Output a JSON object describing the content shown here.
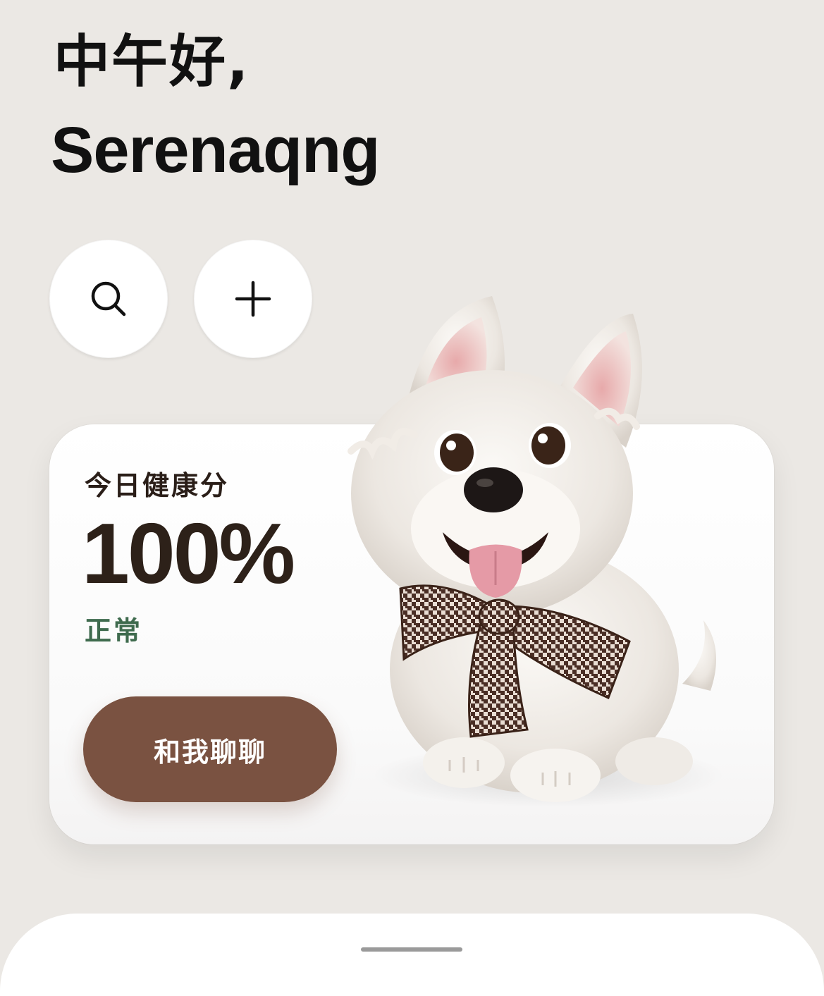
{
  "header": {
    "greeting": "中午好,",
    "username": "Serenaqng"
  },
  "actions": {
    "search_icon": "search-icon",
    "add_icon": "plus-icon"
  },
  "health_card": {
    "label": "今日健康分",
    "score": "100%",
    "status": "正常",
    "chat_button": "和我聊聊",
    "mascot": "white-puppy-with-houndstooth-bow"
  },
  "colors": {
    "background": "#ebe8e4",
    "score_text": "#2d2119",
    "status_text": "#3f6b4e",
    "chat_button": "#7a5241"
  }
}
